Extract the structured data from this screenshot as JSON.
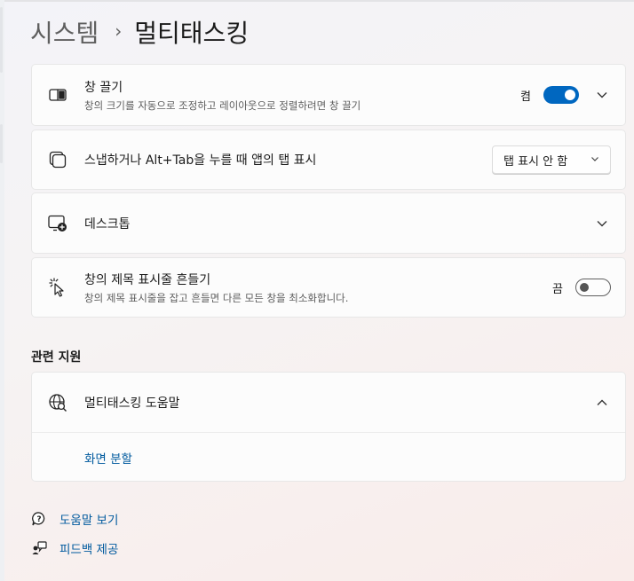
{
  "breadcrumb": {
    "parent": "시스템",
    "separator": "›",
    "current": "멀티태스킹"
  },
  "settings": [
    {
      "title": "창 끌기",
      "description": "창의 크기를 자동으로 조정하고 레이아웃으로 정렬하려면 창 끌기",
      "state_label": "켬",
      "icon": "snap-window-icon"
    },
    {
      "title": "스냅하거나 Alt+Tab을 누를 때 앱의 탭 표시",
      "dropdown_value": "탭 표시 안 함",
      "icon": "tabs-icon"
    },
    {
      "title": "데스크톱",
      "icon": "desktop-add-icon"
    },
    {
      "title": "창의 제목 표시줄 흔들기",
      "description": "창의 제목 표시줄을 잡고 흔들면 다른 모든 창을 최소화합니다.",
      "state_label": "끔",
      "icon": "shake-cursor-icon"
    }
  ],
  "related": {
    "section_title": "관련 지원",
    "help_title": "멀티태스킹 도움말",
    "help_link": "화면 분할"
  },
  "footer": {
    "get_help": "도움말 보기",
    "feedback": "피드백 제공"
  },
  "colors": {
    "accent": "#0067c0",
    "link": "#005a9e"
  }
}
